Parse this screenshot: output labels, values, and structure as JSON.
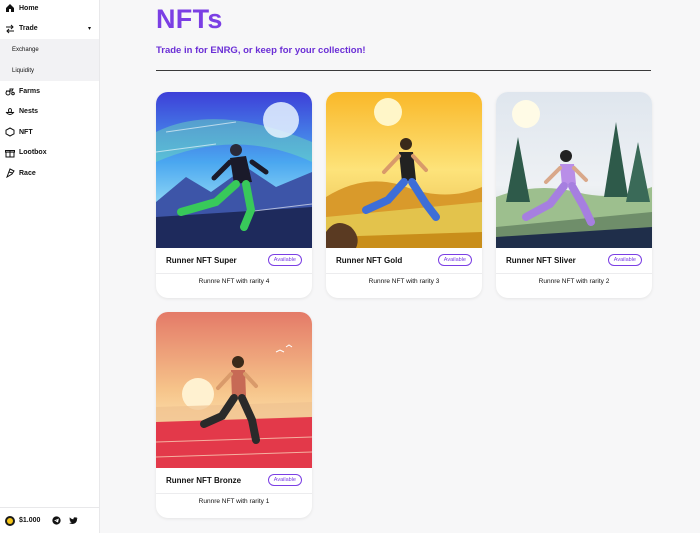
{
  "sidebar": {
    "items": [
      {
        "label": "Home",
        "icon": "home-icon"
      },
      {
        "label": "Trade",
        "icon": "swap-icon"
      },
      {
        "label": "Farms",
        "icon": "tractor-icon"
      },
      {
        "label": "Nests",
        "icon": "nest-icon"
      },
      {
        "label": "NFT",
        "icon": "nft-icon"
      },
      {
        "label": "Lootbox",
        "icon": "lootbox-icon"
      },
      {
        "label": "Race",
        "icon": "race-flag-icon"
      }
    ],
    "trade_caret": "▾",
    "trade_sub": [
      {
        "label": "Exchange"
      },
      {
        "label": "Liquidity"
      }
    ],
    "footer": {
      "price": "$1.000"
    }
  },
  "main": {
    "title": "NFTs",
    "subtitle": "Trade in for ENRG, or keep for your collection!"
  },
  "cards": [
    {
      "name": "Runner NFT Super",
      "badge": "Available",
      "desc": "Runnre NFT with rarity 4"
    },
    {
      "name": "Runner NFT Gold",
      "badge": "Available",
      "desc": "Runnre NFT with rarity 3"
    },
    {
      "name": "Runner NFT Sliver",
      "badge": "Available",
      "desc": "Runnre NFT with rarity 2"
    },
    {
      "name": "Runner NFT Bronze",
      "badge": "Available",
      "desc": "Runnre NFT with rarity 1"
    }
  ],
  "colors": {
    "accent": "#7b3fe4"
  }
}
